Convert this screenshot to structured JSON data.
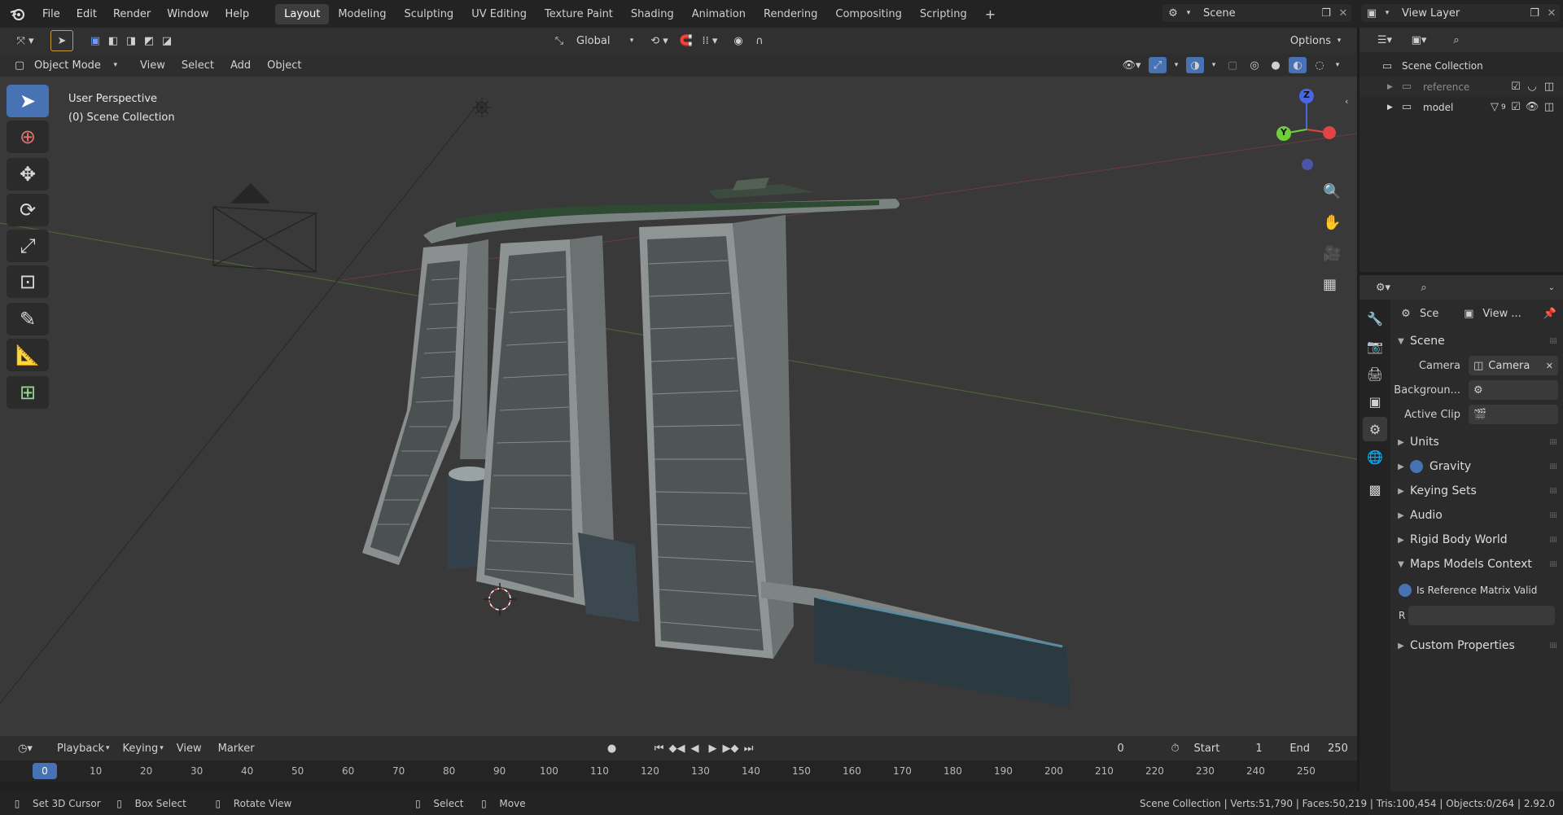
{
  "menu": {
    "items": [
      "File",
      "Edit",
      "Render",
      "Window",
      "Help"
    ]
  },
  "workspaces": {
    "tabs": [
      "Layout",
      "Modeling",
      "Sculpting",
      "UV Editing",
      "Texture Paint",
      "Shading",
      "Animation",
      "Rendering",
      "Compositing",
      "Scripting"
    ],
    "add_symbol": "+"
  },
  "scene_selector": {
    "value": "Scene"
  },
  "view_layer_selector": {
    "value": "View Layer"
  },
  "viewport_header": {
    "transform_orientation": "Global",
    "options_label": "Options",
    "mode": "Object Mode",
    "menus": [
      "View",
      "Select",
      "Add",
      "Object"
    ]
  },
  "viewport": {
    "perspective_label": "User Perspective",
    "collection_label": "(0) Scene Collection",
    "gizmo_axes": [
      "Z",
      "Y"
    ]
  },
  "outliner": {
    "root": "Scene Collection",
    "items": [
      {
        "label": "reference"
      },
      {
        "label": "model",
        "badge": "9"
      }
    ]
  },
  "properties": {
    "context_scene": "Sce",
    "context_view": "View ...",
    "scene_section": "Scene",
    "rows": [
      {
        "label": "Camera",
        "value": "Camera"
      },
      {
        "label": "Backgroun...",
        "value": ""
      },
      {
        "label": "Active Clip",
        "value": ""
      }
    ],
    "sections": [
      "Units",
      "Gravity",
      "Keying Sets",
      "Audio",
      "Rigid Body World",
      "Maps Models Context"
    ],
    "maps_checkbox": "Is Reference Matrix Valid",
    "maps_field_label": "R",
    "custom_section": "Custom Properties"
  },
  "timeline": {
    "menus": [
      "Playback",
      "Keying",
      "View",
      "Marker"
    ],
    "current_frame": "0",
    "start_label": "Start",
    "start_value": "1",
    "end_label": "End",
    "end_value": "250",
    "ticks": [
      "0",
      "10",
      "20",
      "30",
      "40",
      "50",
      "60",
      "70",
      "80",
      "90",
      "100",
      "110",
      "120",
      "130",
      "140",
      "150",
      "160",
      "170",
      "180",
      "190",
      "200",
      "210",
      "220",
      "230",
      "240",
      "250"
    ]
  },
  "statusbar": {
    "hints": [
      "Set 3D Cursor",
      "Box Select",
      "Rotate View",
      "Select",
      "Move"
    ],
    "stats": "Scene Collection | Verts:51,790 | Faces:50,219 | Tris:100,454 | Objects:0/264 | 2.92.0"
  },
  "colors": {
    "accent": "#4772b3",
    "viewport_bg": "#393939",
    "axis_x": "#e04444",
    "axis_y": "#6fcf3a",
    "axis_z": "#4a66e0"
  }
}
